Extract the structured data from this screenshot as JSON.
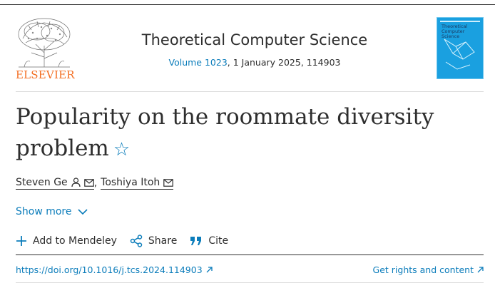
{
  "publisher": {
    "logo_text": "ELSEVIER"
  },
  "journal": {
    "name": "Theoretical Computer Science",
    "volume_link": "Volume 1023",
    "issue_rest": ", 1 January 2025, 114903",
    "cover_title": "Theoretical Computer Science"
  },
  "article": {
    "title": "Popularity on the roommate diversity problem",
    "star_icon": "☆"
  },
  "authors": [
    {
      "name": "Steven Ge",
      "icons": [
        "person-icon",
        "mail-icon"
      ]
    },
    {
      "name": "Toshiya Itoh",
      "icons": [
        "mail-icon"
      ]
    }
  ],
  "author_separator": ",",
  "show_more": "Show more",
  "actions": {
    "mendeley": "Add to Mendeley",
    "share": "Share",
    "cite": "Cite"
  },
  "doi": "https://doi.org/10.1016/j.tcs.2024.114903",
  "rights": "Get rights and content",
  "colors": {
    "link": "#0c7dbb",
    "brand": "#f36d21",
    "text": "#2e2e2e"
  }
}
